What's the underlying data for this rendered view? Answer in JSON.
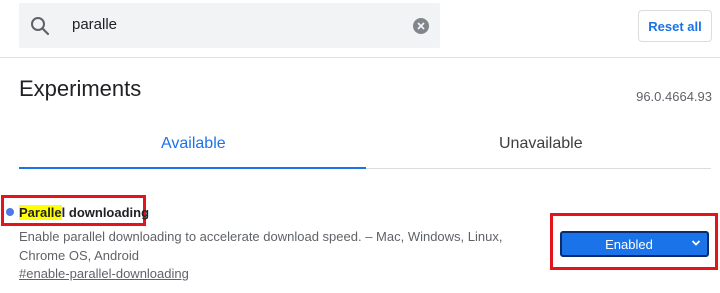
{
  "search": {
    "value": "paralle",
    "icon": "search-icon",
    "clear_icon": "clear-icon"
  },
  "toolbar": {
    "reset_label": "Reset all"
  },
  "header": {
    "title": "Experiments",
    "version": "96.0.4664.93"
  },
  "tabs": [
    {
      "label": "Available",
      "selected": true
    },
    {
      "label": "Unavailable",
      "selected": false
    }
  ],
  "experiment": {
    "name_highlight": "Paralle",
    "name_rest": "l downloading",
    "description": "Enable parallel downloading to accelerate download speed. – Mac, Windows, Linux, Chrome OS, Android",
    "link": "#enable-parallel-downloading",
    "state": "Enabled"
  },
  "colors": {
    "accent": "#1a73e8",
    "highlight": "#ffff00",
    "annotation_box": "#e3141b"
  }
}
